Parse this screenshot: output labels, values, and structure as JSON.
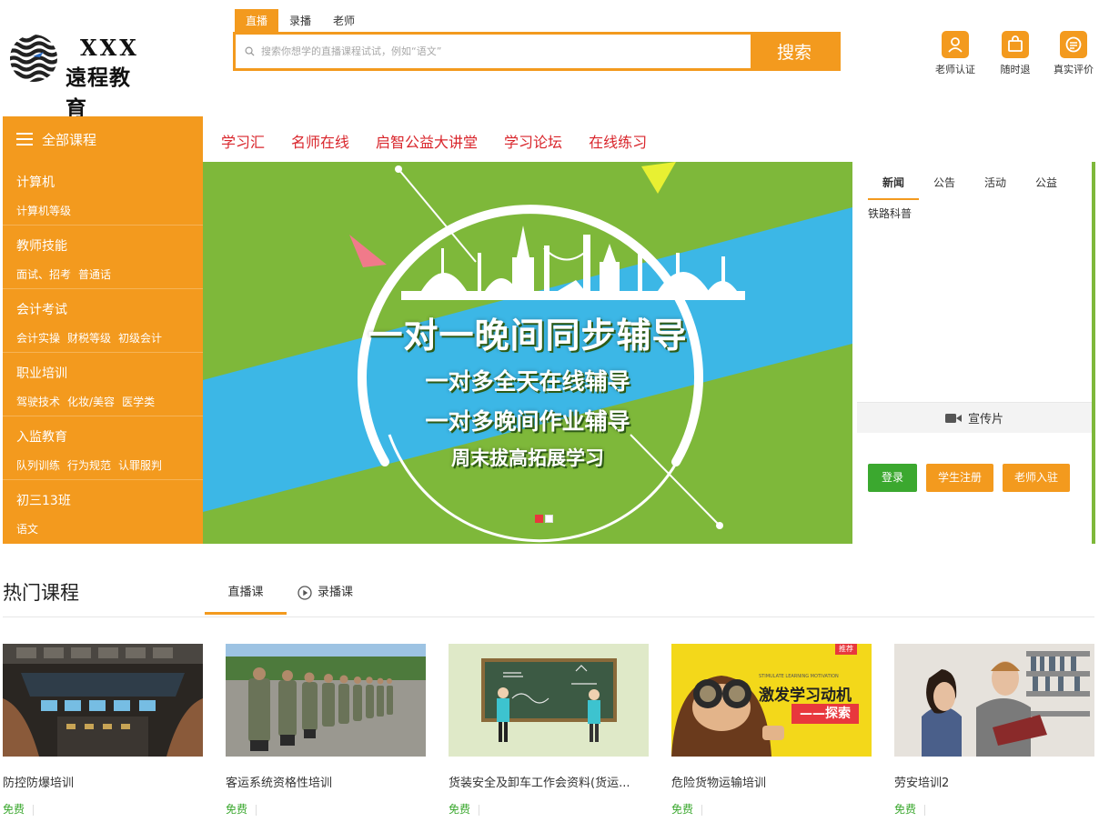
{
  "logo": {
    "line1": "XXX",
    "line2": "遠程教育"
  },
  "search": {
    "tabs": [
      "直播",
      "录播",
      "老师"
    ],
    "placeholder": "搜索你想学的直播课程试试，例如“语文”",
    "button": "搜索"
  },
  "features": [
    {
      "label": "老师认证",
      "icon": "teacher-cert-icon"
    },
    {
      "label": "随时退",
      "icon": "refund-icon"
    },
    {
      "label": "真实评价",
      "icon": "review-icon"
    }
  ],
  "nav": {
    "all_courses": "全部课程",
    "links": [
      "学习汇",
      "名师在线",
      "启智公益大讲堂",
      "学习论坛",
      "在线练习"
    ]
  },
  "sidebar": {
    "categories": [
      {
        "title": "计算机",
        "subs": [
          "计算机等级"
        ]
      },
      {
        "title": "教师技能",
        "subs": [
          "面试、招考",
          "普通话"
        ]
      },
      {
        "title": "会计考试",
        "subs": [
          "会计实操",
          "财税等级",
          "初级会计"
        ]
      },
      {
        "title": "职业培训",
        "subs": [
          "驾驶技术",
          "化妆/美容",
          "医学类"
        ]
      },
      {
        "title": "入监教育",
        "subs": [
          "队列训练",
          "行为规范",
          "认罪服判"
        ]
      },
      {
        "title": "初三13班",
        "subs": [
          "语文"
        ]
      }
    ]
  },
  "banner": {
    "line1": "一对一晚间同步辅导",
    "line2": "一对多全天在线辅导",
    "line3": "一对多晚间作业辅导",
    "line4": "周末拔高拓展学习"
  },
  "news": {
    "tabs": [
      "新闻",
      "公告",
      "活动",
      "公益"
    ],
    "items": [
      "铁路科普"
    ],
    "promo": "宣传片",
    "login": "登录",
    "student_register": "学生注册",
    "teacher_join": "老师入驻"
  },
  "hot": {
    "title": "热门课程",
    "tab_live": "直播课",
    "tab_recorded": "录播课"
  },
  "courses": [
    {
      "name": "防控防爆培训",
      "price": "免费"
    },
    {
      "name": "客运系统资格性培训",
      "price": "免费"
    },
    {
      "name": "货装安全及卸车工作会资料(货运...",
      "price": "免费"
    },
    {
      "name": "危险货物运输培训",
      "price": "免费",
      "image_text": "激发学习动机",
      "image_button": "——探索",
      "badge": "推荐",
      "image_caption": "STIMULATE LEARNING MOTIVATION"
    },
    {
      "name": "劳安培训2",
      "price": "免费"
    }
  ],
  "colors": {
    "accent": "#f39a1e",
    "nav_red": "#d9262c",
    "green": "#3ba82f",
    "banner_green": "#7eb83a",
    "banner_blue": "#3cb7e6"
  }
}
